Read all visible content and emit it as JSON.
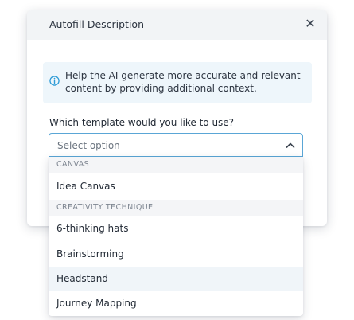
{
  "modal": {
    "title": "Autofill Description",
    "close_symbol": "✕"
  },
  "info": {
    "icon": "info-icon",
    "text": "Help the AI generate more accurate and relevant content by providing additional context."
  },
  "template_field": {
    "label": "Which template would you like to use?",
    "placeholder": "Select option",
    "chevron": "chevron-up-icon"
  },
  "dropdown": {
    "groups": [
      {
        "header": "CANVAS",
        "options": [
          "Idea Canvas"
        ]
      },
      {
        "header": "CREATIVITY TECHNIQUE",
        "options": [
          "6-thinking hats",
          "Brainstorming",
          "Headstand",
          "Journey Mapping"
        ]
      }
    ],
    "highlighted_option": "Headstand"
  },
  "colors": {
    "accent_border": "#5aa6d6",
    "info_background": "#eef6fb",
    "info_icon": "#2d9bd6",
    "header_background": "#f2f4f6"
  }
}
